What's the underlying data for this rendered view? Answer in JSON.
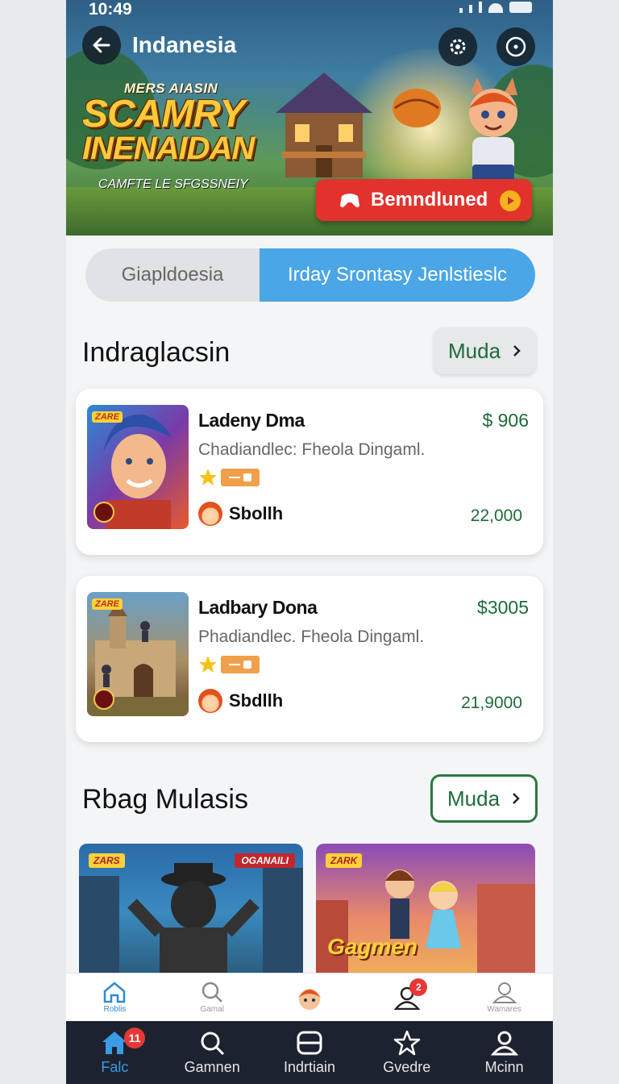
{
  "status_bar": {
    "time": "10:49"
  },
  "hero": {
    "title": "Indanesia",
    "logo_line1": "MERS AIASIN",
    "logo_line2": "SCAMRY",
    "logo_line3": "INENAIDAN",
    "logo_subtitle": "CAMFTE LE SFGSSNEIY",
    "cta_label": "Bemndluned"
  },
  "tabs": [
    {
      "label": "Giapldoesia",
      "active": false
    },
    {
      "label": "Irday Srontasy Jenlstieslc",
      "active": true
    }
  ],
  "section1": {
    "title": "Indraglacsin",
    "more_label": "Muda",
    "cards": [
      {
        "name": "Ladeny Dma",
        "price": "$ 906",
        "description": "Chadiandlec: Fheola Dingaml.",
        "seller": "Sbollh",
        "count": "22,000",
        "tag": "ZARE"
      },
      {
        "name": "Ladbary Dona",
        "price": "$3005",
        "description": "Phadiandlec. Fheola Dingaml.",
        "seller": "Sbdllh",
        "count": "21,9000",
        "tag": "ZARE"
      }
    ]
  },
  "section2": {
    "title": "Rbag Mulasis",
    "more_label": "Muda",
    "tiles": [
      {
        "tag1": "ZARS",
        "tag2": "OGANAILI"
      },
      {
        "tag1": "ZARK",
        "game_text": "Gagmen"
      }
    ]
  },
  "nav_light": [
    {
      "label": "Roblis",
      "icon": "home-icon",
      "active": true
    },
    {
      "label": "Gamal",
      "icon": "search-icon",
      "active": false
    },
    {
      "label": "",
      "icon": "avatar-icon",
      "active": false
    },
    {
      "label": "",
      "icon": "user-icon",
      "active": false,
      "badge": "2"
    },
    {
      "label": "Wamares",
      "icon": "profile-icon",
      "active": false
    }
  ],
  "nav_dark": [
    {
      "label": "Falc",
      "icon": "home-icon",
      "active": true,
      "badge": "11"
    },
    {
      "label": "Gamnen",
      "icon": "search-icon",
      "active": false
    },
    {
      "label": "Indrtiain",
      "icon": "library-icon",
      "active": false
    },
    {
      "label": "Gvedre",
      "icon": "star-icon",
      "active": false
    },
    {
      "label": "Mcinn",
      "icon": "profile-icon",
      "active": false
    }
  ],
  "colors": {
    "accent_blue": "#4aa6e6",
    "cta_red": "#e2322c",
    "price_green": "#1f6b3a",
    "nav_dark_bg": "#1c2230"
  }
}
